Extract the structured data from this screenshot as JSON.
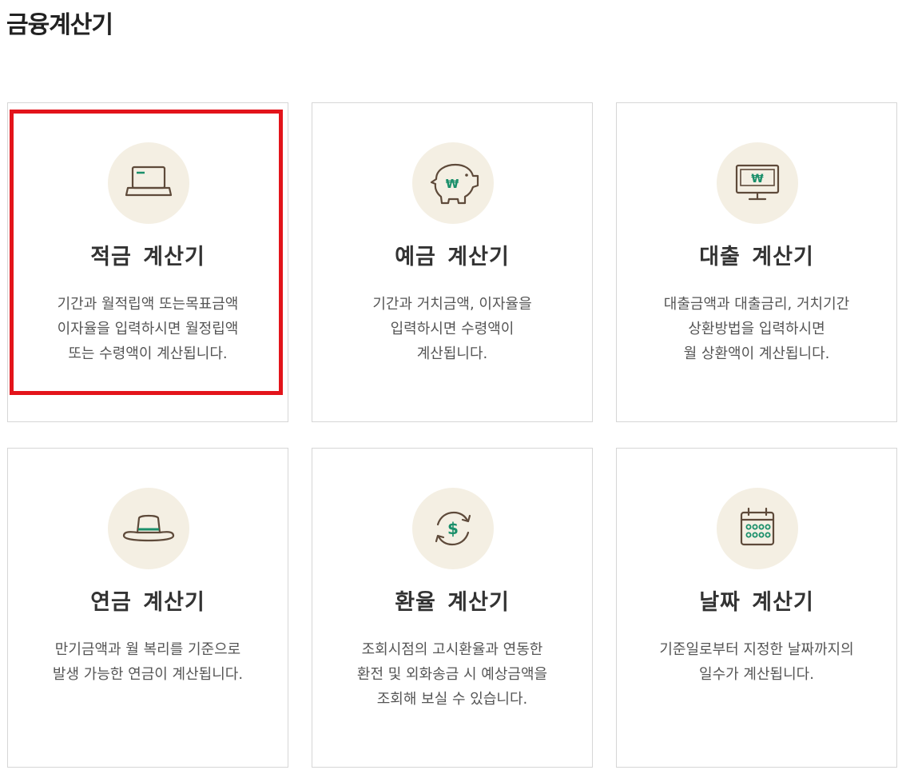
{
  "page": {
    "title": "금융계산기"
  },
  "colors": {
    "icon_bg": "#f4efe3",
    "icon_stroke": "#5e4a3a",
    "icon_accent": "#1a8f6a",
    "highlight": "#e3141b"
  },
  "cards": [
    {
      "title": "적금 계산기",
      "icon": "laptop-icon",
      "desc": [
        "기간과 월적립액 또는목표금액",
        "이자율을 입력하시면 월정립액",
        "또는 수령액이 계산됩니다."
      ]
    },
    {
      "title": "예금 계산기",
      "icon": "piggy-bank-icon",
      "desc": [
        "기간과 거치금액, 이자율을",
        "입력하시면 수령액이",
        "계산됩니다."
      ]
    },
    {
      "title": "대출 계산기",
      "icon": "monitor-icon",
      "desc": [
        "대출금액과 대출금리, 거치기간",
        "상환방법을 입력하시면",
        "월 상환액이 계산됩니다."
      ]
    },
    {
      "title": "연금 계산기",
      "icon": "hat-icon",
      "desc": [
        "만기금액과 월 복리를 기준으로",
        "발생 가능한 연금이 계산됩니다."
      ]
    },
    {
      "title": "환율 계산기",
      "icon": "currency-exchange-icon",
      "desc": [
        "조회시점의 고시환율과 연동한",
        "환전 및 외화송금 시 예상금액을",
        "조회해 보실 수 있습니다."
      ]
    },
    {
      "title": "날짜 계산기",
      "icon": "calendar-icon",
      "desc": [
        "기준일로부터 지정한 날짜까지의",
        "일수가 계산됩니다."
      ]
    }
  ],
  "icon_glyphs": {
    "won": "₩",
    "dollar": "$"
  }
}
